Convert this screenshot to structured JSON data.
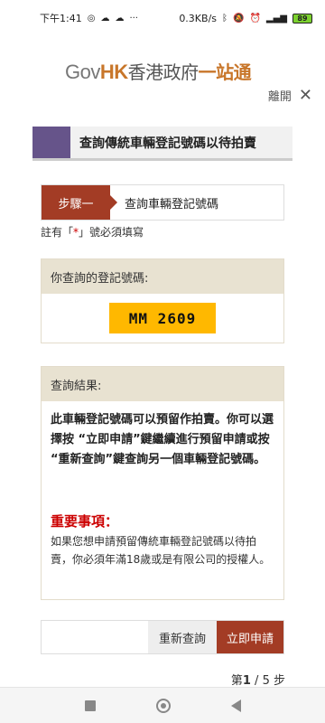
{
  "status_bar": {
    "time": "下午1:41",
    "net_speed": "0.3KB/s",
    "battery": "89",
    "icons": [
      "whatsapp-icon",
      "cloud-icon",
      "cloud-icon",
      "more-icon",
      "bluetooth-icon",
      "mute-icon",
      "alarm-icon",
      "hd-icon",
      "signal-icon",
      "battery-icon"
    ]
  },
  "header": {
    "logo_gov": "Gov",
    "logo_hk": "HK",
    "logo_cn": "香港政府",
    "logo_cn2": "一站通",
    "leave_label": "離開"
  },
  "page_title": "查詢傳統車輛登記號碼以待拍賣",
  "step": {
    "tag": "步驟一",
    "label": "查詢車輛登記號碼"
  },
  "required_note": {
    "prefix": "註有「",
    "star": "*",
    "suffix": "」號必須填寫"
  },
  "query_panel": {
    "heading": "你查詢的登記號碼:",
    "plate": "MM 2609"
  },
  "result_panel": {
    "heading": "查詢結果:",
    "result_text": "此車輛登記號碼可以預留作拍賣。你可以選擇按 “立即申請”鍵繼續進行預留申請或按 “重新查詢”鍵查詢另一個車輛登記號碼。",
    "important_title": "重要事項：",
    "important_text": "如果您想申請預留傳統車輛登記號碼以待拍賣，你必須年滿18歲或是有限公司的授權人。"
  },
  "buttons": {
    "requery": "重新查詢",
    "apply": "立即申請"
  },
  "pager": {
    "prefix": "第",
    "current": "1",
    "separator": " / ",
    "total": "5",
    "suffix": "步"
  },
  "colors": {
    "brand_orange": "#c8762a",
    "accent_red": "#a33c25",
    "title_swatch": "#66548a",
    "plate_yellow": "#ffb800"
  }
}
